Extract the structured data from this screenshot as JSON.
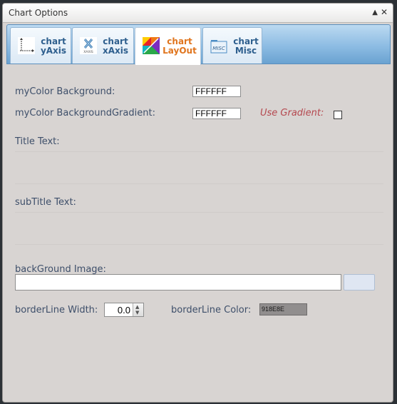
{
  "window": {
    "title": "Chart Options"
  },
  "tabs": [
    {
      "line1": "chart",
      "line2": "yAxis",
      "icon": "y-axis-chart-icon"
    },
    {
      "line1": "chart",
      "line2": "xAxis",
      "icon": "x-axis-chart-icon",
      "icon_caption": "XAXIS"
    },
    {
      "line1": "chart",
      "line2": "LayOut",
      "icon": "color-palette-icon",
      "active": true
    },
    {
      "line1": "chart",
      "line2": "Misc",
      "icon": "misc-folder-icon",
      "icon_caption": "MISC"
    }
  ],
  "form": {
    "bg_label": "myColor Background:",
    "bg_value": "FFFFFF",
    "gradient_label": "myColor BackgroundGradient:",
    "gradient_value": "FFFFFF",
    "use_gradient_label": "Use Gradient:",
    "use_gradient_checked": false,
    "title_label": "Title Text:",
    "title_value": "",
    "subtitle_label": "subTitle Text:",
    "subtitle_value": "",
    "bg_image_label": "backGround Image:",
    "bg_image_value": "",
    "border_width_label": "borderLine Width:",
    "border_width_value": "0.0",
    "border_color_label": "borderLine Color:",
    "border_color_value": "918E8E"
  },
  "colors": {
    "label_text": "#3e4f6a",
    "active_tab_text": "#e0751e",
    "tab_text": "#2e5f8e",
    "use_gradient_text": "#b5484f",
    "border_color_swatch": "#918e8e"
  }
}
